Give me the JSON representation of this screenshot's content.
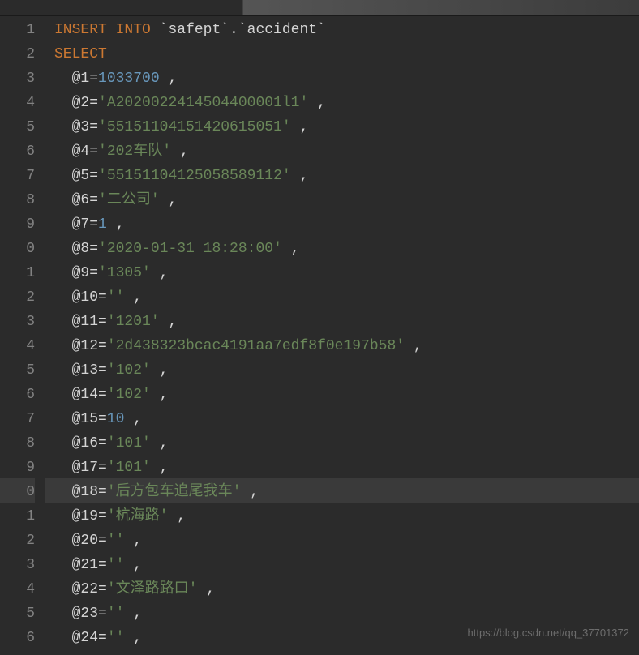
{
  "watermark": "https://blog.csdn.net/qq_37701372",
  "gutter": [
    "1",
    "2",
    "3",
    "4",
    "5",
    "6",
    "7",
    "8",
    "9",
    "0",
    "1",
    "2",
    "3",
    "4",
    "5",
    "6",
    "7",
    "8",
    "9",
    "0",
    "1",
    "2",
    "3",
    "4",
    "5",
    "6"
  ],
  "highlightedLine": 19,
  "lines": [
    {
      "indent": 0,
      "tokens": [
        {
          "t": "keyword",
          "v": "INSERT INTO"
        },
        {
          "t": "plain",
          "v": " `"
        },
        {
          "t": "identifier",
          "v": "safept"
        },
        {
          "t": "plain",
          "v": "`.`"
        },
        {
          "t": "identifier",
          "v": "accident"
        },
        {
          "t": "plain",
          "v": "`"
        }
      ]
    },
    {
      "indent": 0,
      "tokens": [
        {
          "t": "keyword",
          "v": "SELECT"
        }
      ]
    },
    {
      "indent": 1,
      "tokens": [
        {
          "t": "identifier",
          "v": "@1"
        },
        {
          "t": "plain",
          "v": "="
        },
        {
          "t": "number",
          "v": "1033700"
        },
        {
          "t": "plain",
          "v": " ,"
        }
      ]
    },
    {
      "indent": 1,
      "tokens": [
        {
          "t": "identifier",
          "v": "@2"
        },
        {
          "t": "plain",
          "v": "="
        },
        {
          "t": "string",
          "v": "'A2020022414504400001l1'"
        },
        {
          "t": "plain",
          "v": " ,"
        }
      ]
    },
    {
      "indent": 1,
      "tokens": [
        {
          "t": "identifier",
          "v": "@3"
        },
        {
          "t": "plain",
          "v": "="
        },
        {
          "t": "string",
          "v": "'55151104151420615051'"
        },
        {
          "t": "plain",
          "v": " ,"
        }
      ]
    },
    {
      "indent": 1,
      "tokens": [
        {
          "t": "identifier",
          "v": "@4"
        },
        {
          "t": "plain",
          "v": "="
        },
        {
          "t": "string",
          "v": "'202车队'"
        },
        {
          "t": "plain",
          "v": " ,"
        }
      ]
    },
    {
      "indent": 1,
      "tokens": [
        {
          "t": "identifier",
          "v": "@5"
        },
        {
          "t": "plain",
          "v": "="
        },
        {
          "t": "string",
          "v": "'55151104125058589112'"
        },
        {
          "t": "plain",
          "v": " ,"
        }
      ]
    },
    {
      "indent": 1,
      "tokens": [
        {
          "t": "identifier",
          "v": "@6"
        },
        {
          "t": "plain",
          "v": "="
        },
        {
          "t": "string",
          "v": "'二公司'"
        },
        {
          "t": "plain",
          "v": " ,"
        }
      ]
    },
    {
      "indent": 1,
      "tokens": [
        {
          "t": "identifier",
          "v": "@7"
        },
        {
          "t": "plain",
          "v": "="
        },
        {
          "t": "number",
          "v": "1"
        },
        {
          "t": "plain",
          "v": " ,"
        }
      ]
    },
    {
      "indent": 1,
      "tokens": [
        {
          "t": "identifier",
          "v": "@8"
        },
        {
          "t": "plain",
          "v": "="
        },
        {
          "t": "string",
          "v": "'2020-01-31 18:28:00'"
        },
        {
          "t": "plain",
          "v": " ,"
        }
      ]
    },
    {
      "indent": 1,
      "tokens": [
        {
          "t": "identifier",
          "v": "@9"
        },
        {
          "t": "plain",
          "v": "="
        },
        {
          "t": "string",
          "v": "'1305'"
        },
        {
          "t": "plain",
          "v": " ,"
        }
      ]
    },
    {
      "indent": 1,
      "tokens": [
        {
          "t": "identifier",
          "v": "@10"
        },
        {
          "t": "plain",
          "v": "="
        },
        {
          "t": "string",
          "v": "''"
        },
        {
          "t": "plain",
          "v": " ,"
        }
      ]
    },
    {
      "indent": 1,
      "tokens": [
        {
          "t": "identifier",
          "v": "@11"
        },
        {
          "t": "plain",
          "v": "="
        },
        {
          "t": "string",
          "v": "'1201'"
        },
        {
          "t": "plain",
          "v": " ,"
        }
      ]
    },
    {
      "indent": 1,
      "tokens": [
        {
          "t": "identifier",
          "v": "@12"
        },
        {
          "t": "plain",
          "v": "="
        },
        {
          "t": "string",
          "v": "'2d438323bcac4191aa7edf8f0e197b58'"
        },
        {
          "t": "plain",
          "v": " ,"
        }
      ]
    },
    {
      "indent": 1,
      "tokens": [
        {
          "t": "identifier",
          "v": "@13"
        },
        {
          "t": "plain",
          "v": "="
        },
        {
          "t": "string",
          "v": "'102'"
        },
        {
          "t": "plain",
          "v": " ,"
        }
      ]
    },
    {
      "indent": 1,
      "tokens": [
        {
          "t": "identifier",
          "v": "@14"
        },
        {
          "t": "plain",
          "v": "="
        },
        {
          "t": "string",
          "v": "'102'"
        },
        {
          "t": "plain",
          "v": " ,"
        }
      ]
    },
    {
      "indent": 1,
      "tokens": [
        {
          "t": "identifier",
          "v": "@15"
        },
        {
          "t": "plain",
          "v": "="
        },
        {
          "t": "number",
          "v": "10"
        },
        {
          "t": "plain",
          "v": " ,"
        }
      ]
    },
    {
      "indent": 1,
      "tokens": [
        {
          "t": "identifier",
          "v": "@16"
        },
        {
          "t": "plain",
          "v": "="
        },
        {
          "t": "string",
          "v": "'101'"
        },
        {
          "t": "plain",
          "v": " ,"
        }
      ]
    },
    {
      "indent": 1,
      "tokens": [
        {
          "t": "identifier",
          "v": "@17"
        },
        {
          "t": "plain",
          "v": "="
        },
        {
          "t": "string",
          "v": "'101'"
        },
        {
          "t": "plain",
          "v": " ,"
        }
      ]
    },
    {
      "indent": 1,
      "tokens": [
        {
          "t": "identifier",
          "v": "@18"
        },
        {
          "t": "plain",
          "v": "="
        },
        {
          "t": "string",
          "v": "'后方包车追尾我车'"
        },
        {
          "t": "plain",
          "v": " ,"
        }
      ]
    },
    {
      "indent": 1,
      "tokens": [
        {
          "t": "identifier",
          "v": "@19"
        },
        {
          "t": "plain",
          "v": "="
        },
        {
          "t": "string",
          "v": "'杭海路'"
        },
        {
          "t": "plain",
          "v": " ,"
        }
      ]
    },
    {
      "indent": 1,
      "tokens": [
        {
          "t": "identifier",
          "v": "@20"
        },
        {
          "t": "plain",
          "v": "="
        },
        {
          "t": "string",
          "v": "''"
        },
        {
          "t": "plain",
          "v": " ,"
        }
      ]
    },
    {
      "indent": 1,
      "tokens": [
        {
          "t": "identifier",
          "v": "@21"
        },
        {
          "t": "plain",
          "v": "="
        },
        {
          "t": "string",
          "v": "''"
        },
        {
          "t": "plain",
          "v": " ,"
        }
      ]
    },
    {
      "indent": 1,
      "tokens": [
        {
          "t": "identifier",
          "v": "@22"
        },
        {
          "t": "plain",
          "v": "="
        },
        {
          "t": "string",
          "v": "'文泽路路口'"
        },
        {
          "t": "plain",
          "v": " ,"
        }
      ]
    },
    {
      "indent": 1,
      "tokens": [
        {
          "t": "identifier",
          "v": "@23"
        },
        {
          "t": "plain",
          "v": "="
        },
        {
          "t": "string",
          "v": "''"
        },
        {
          "t": "plain",
          "v": " ,"
        }
      ]
    },
    {
      "indent": 1,
      "tokens": [
        {
          "t": "identifier",
          "v": "@24"
        },
        {
          "t": "plain",
          "v": "="
        },
        {
          "t": "string",
          "v": "''"
        },
        {
          "t": "plain",
          "v": " ,"
        }
      ]
    }
  ]
}
